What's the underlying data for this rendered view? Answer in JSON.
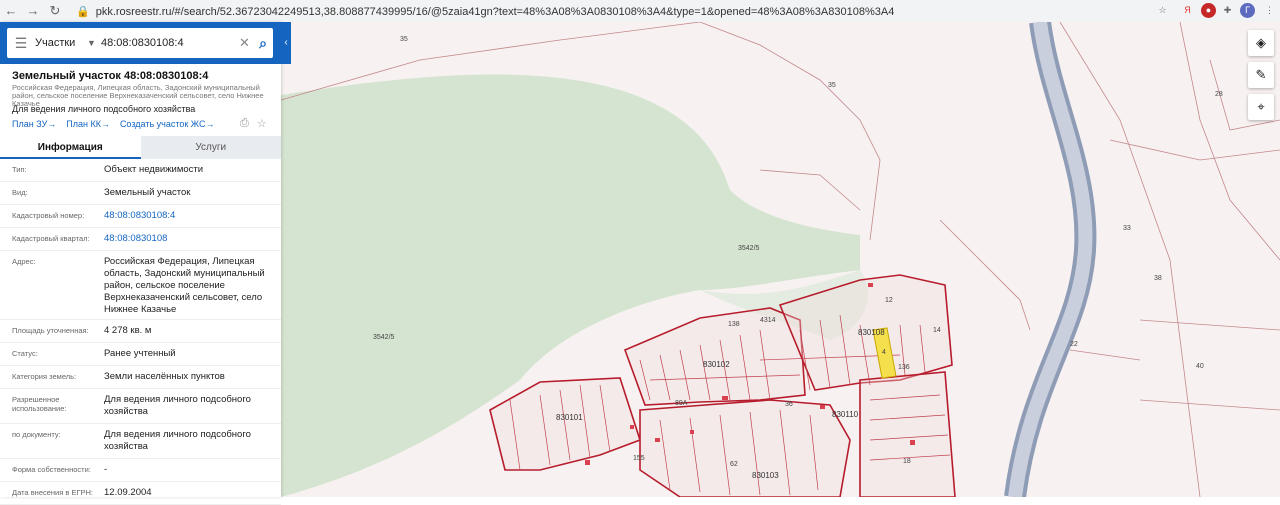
{
  "browser": {
    "url": "pkk.rosreestr.ru/#/search/52.36723042249513,38.808877439995/16/@5zaia41gn?text=48%3A08%3A0830108%3A4&type=1&opened=48%3A08%3A830108%3A4",
    "back": "←",
    "forward": "→",
    "reload": "↻",
    "lock": "🔒"
  },
  "search": {
    "category": "Участки",
    "query": "48:08:0830108:4"
  },
  "parcel": {
    "title": "Земельный участок 48:08:0830108:4",
    "address_small": "Российская Федерация, Липецкая область, Задонский муниципальный район, сельское поселение Верхнеказаченский сельсовет, село Нижнее Казачье",
    "purpose": "Для ведения личного подсобного хозяйства",
    "links": [
      "План ЗУ→",
      "План КК→",
      "Создать участок ЖС→"
    ]
  },
  "tabs": {
    "info": "Информация",
    "services": "Услуги"
  },
  "rows": [
    {
      "label": "Тип:",
      "value": "Объект недвижимости",
      "link": false
    },
    {
      "label": "Вид:",
      "value": "Земельный участок",
      "link": false
    },
    {
      "label": "Кадастровый номер:",
      "value": "48:08:0830108:4",
      "link": true
    },
    {
      "label": "Кадастровый квартал:",
      "value": "48:08:0830108",
      "link": true
    },
    {
      "label": "Адрес:",
      "value": "Российская Федерация, Липецкая область, Задонский муниципальный район, сельское поселение Верхнеказаченский сельсовет, село Нижнее Казачье",
      "link": false
    },
    {
      "label": "Площадь уточненная:",
      "value": "4 278 кв. м",
      "link": false
    },
    {
      "label": "Статус:",
      "value": "Ранее учтенный",
      "link": false
    },
    {
      "label": "Категория земель:",
      "value": "Земли населённых пунктов",
      "link": false
    },
    {
      "label": "Разрешенное использование:",
      "value": "Для ведения личного подсобного хозяйства",
      "link": false
    },
    {
      "label": "по документу:",
      "value": "Для ведения личного подсобного хозяйства",
      "link": false
    },
    {
      "label": "Форма собственности:",
      "value": "-",
      "link": false
    },
    {
      "label": "Дата внесения в ЕГРН:",
      "value": "12.09.2004",
      "link": false
    }
  ],
  "map_labels": {
    "l35a": "35",
    "l35b": "35",
    "l28": "28",
    "l33": "33",
    "l38": "38",
    "l40": "40",
    "l22": "22",
    "l3542a": "3542/5",
    "l3542b": "3542/5",
    "l12": "12",
    "l830108": "830108",
    "l14": "14",
    "l830102": "830102",
    "l830101": "830101",
    "l830110": "830110",
    "l830103": "830103",
    "l138": "138",
    "l4314": "4314",
    "l155": "155",
    "l36": "36",
    "l89a": "89А",
    "l18": "18",
    "l62": "62",
    "l4": "4",
    "l136": "136"
  },
  "map_controls": {
    "layers": "◈",
    "ruler": "✎",
    "locate": "⌖"
  },
  "colors": {
    "accent": "#1565c0",
    "parcel_border": "#b71c2c",
    "selected_parcel": "#f4e04d",
    "road": "#8f9cb6",
    "forest": "#d4e3cf"
  }
}
